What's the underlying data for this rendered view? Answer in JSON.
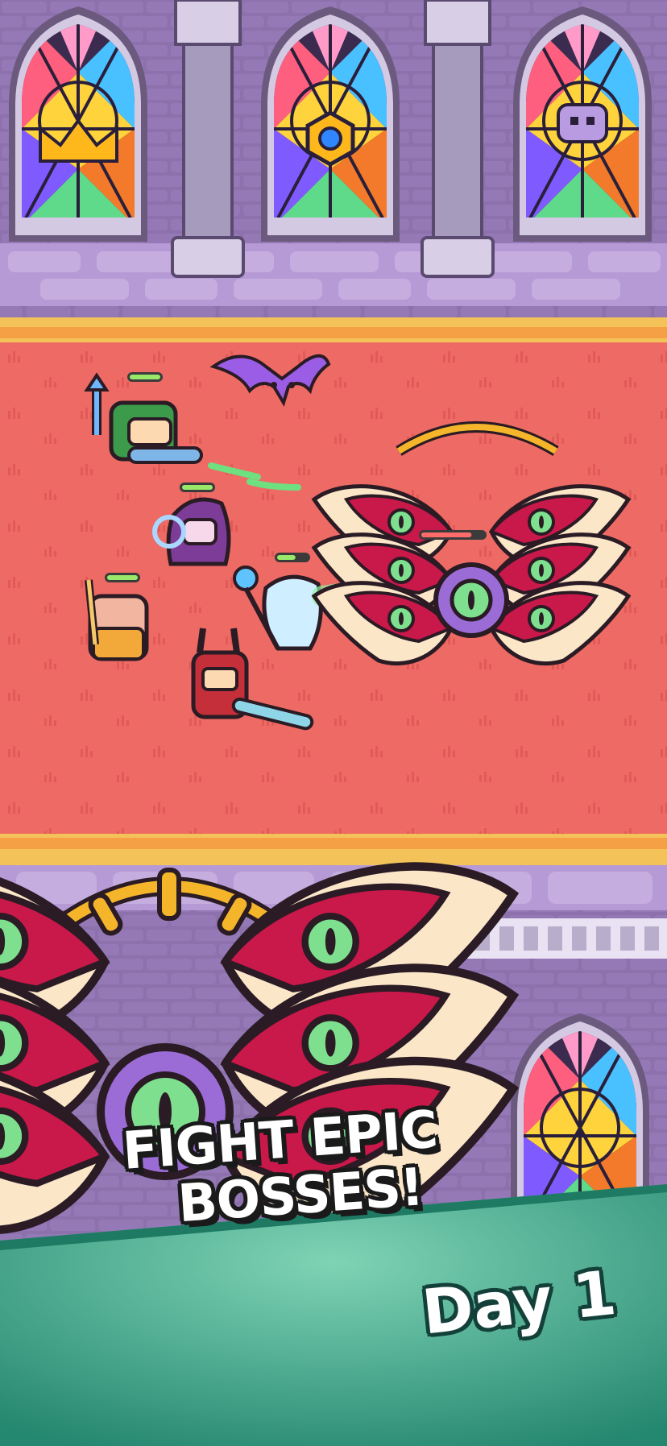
{
  "screen": {
    "headline": {
      "line1": "FIGHT EPIC",
      "line2": "BOSSES!"
    },
    "day_label": "Day 1"
  },
  "colors": {
    "wall": "#8b6fae",
    "carpet": "#ee6a64",
    "carpet_trim": "#f6a046",
    "banner_teal": "#2e9a80",
    "boss_wing_red": "#c9184a",
    "boss_wing_cream": "#fbe6c8",
    "boss_eye_green": "#6ad38a",
    "halo_yellow": "#f5b52b"
  },
  "icons": [
    "stained-glass-window",
    "stone-pillar",
    "bat-enemy",
    "hero-archer",
    "hero-mage",
    "hero-monk",
    "hero-priest",
    "hero-knight",
    "seraph-boss",
    "health-bar"
  ],
  "party_health": [
    {
      "hero": "archer",
      "level": 1.0
    },
    {
      "hero": "mage",
      "level": 1.0
    },
    {
      "hero": "monk",
      "level": 1.0
    },
    {
      "hero": "priest",
      "level": 0.6
    }
  ],
  "boss_health": 0.8
}
